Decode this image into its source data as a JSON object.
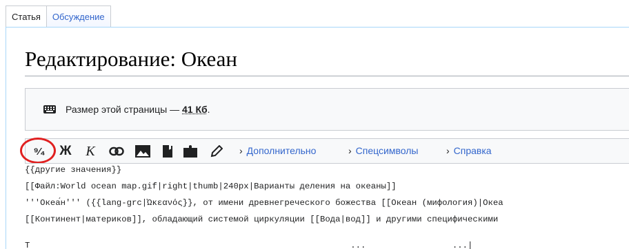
{
  "tabs": {
    "article": "Статья",
    "discussion": "Обсуждение"
  },
  "page": {
    "title": "Редактирование: Океан"
  },
  "notice": {
    "text": "Размер этой страницы — ",
    "size": "41 Кб",
    "period": "."
  },
  "toolbar": {
    "signature": "⁹⁄₄",
    "bold": "Ж",
    "italic": "К",
    "menus": [
      {
        "label": "Дополнительно"
      },
      {
        "label": "Спецсимволы"
      },
      {
        "label": "Справка"
      }
    ]
  },
  "editor": {
    "lines": [
      "{{другие значения}}",
      "[[Файл:World ocean map.gif|right|thumb|240px|Варианты деления на океаны]]",
      "'''Океа́н''' ({{lang-grc|Ὠκεανός}}, от имени древнегреческого божества [[Океан (мифология)|Океа",
      "[[Континент|материков]], обладающий системой циркуляции [[Вода|вод]] и другими специфическими",
      "Т                                                               ...                 ...|  "
    ]
  },
  "colors": {
    "link": "#3366cc",
    "highlight_circle": "#e02020"
  }
}
